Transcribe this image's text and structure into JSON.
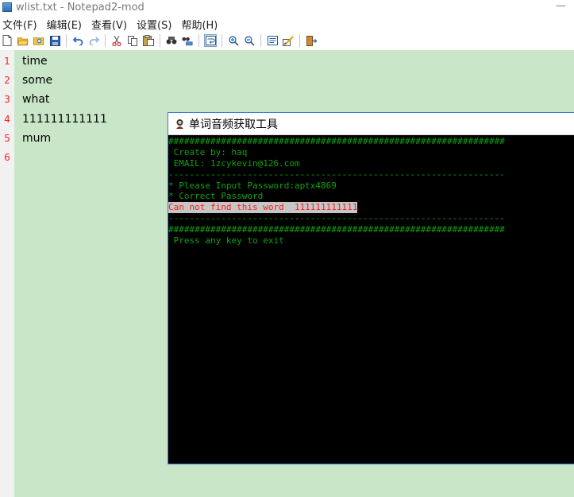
{
  "window": {
    "title": "wlist.txt - Notepad2-mod",
    "minimize_glyph": "—"
  },
  "menu": [
    {
      "label": "文件(F)"
    },
    {
      "label": "编辑(E)"
    },
    {
      "label": "查看(V)"
    },
    {
      "label": "设置(S)"
    },
    {
      "label": "帮助(H)"
    }
  ],
  "toolbar": [
    "new-file-icon",
    "open-folder-icon",
    "browse-icon",
    "save-icon",
    "sep",
    "undo-icon",
    "redo-icon",
    "sep",
    "cut-icon",
    "copy-icon",
    "paste-icon",
    "sep",
    "find-icon",
    "replace-icon",
    "sep",
    "word-wrap-icon",
    "sep",
    "zoom-in-icon",
    "zoom-out-icon",
    "sep",
    "select-scheme-icon",
    "customize-scheme-icon",
    "sep",
    "exit-icon"
  ],
  "editor": {
    "background": "#c9e6c9",
    "lines": [
      {
        "num": "1",
        "text": "time"
      },
      {
        "num": "2",
        "text": "some"
      },
      {
        "num": "3",
        "text": "what"
      },
      {
        "num": "4",
        "text": "111111111111"
      },
      {
        "num": "5",
        "text": "mum"
      },
      {
        "num": "6",
        "text": ""
      }
    ]
  },
  "console": {
    "title": "单词音频获取工具",
    "lines": [
      {
        "text": "################################################################",
        "style": "green"
      },
      {
        "text": " Create by: haq",
        "style": "green"
      },
      {
        "text": " EMAIL: 1zcykevin@126.com",
        "style": "green"
      },
      {
        "text": "----------------------------------------------------------------",
        "style": "green"
      },
      {
        "text": "* Please Input Password:aptx4869",
        "style": "green"
      },
      {
        "text": "* Correct Password",
        "style": "green"
      },
      {
        "text": "Can not find this word  111111111111",
        "style": "red"
      },
      {
        "text": "----------------------------------------------------------------",
        "style": "green"
      },
      {
        "text": "################################################################",
        "style": "green"
      },
      {
        "text": " Press any key to exit",
        "style": "green"
      }
    ]
  }
}
